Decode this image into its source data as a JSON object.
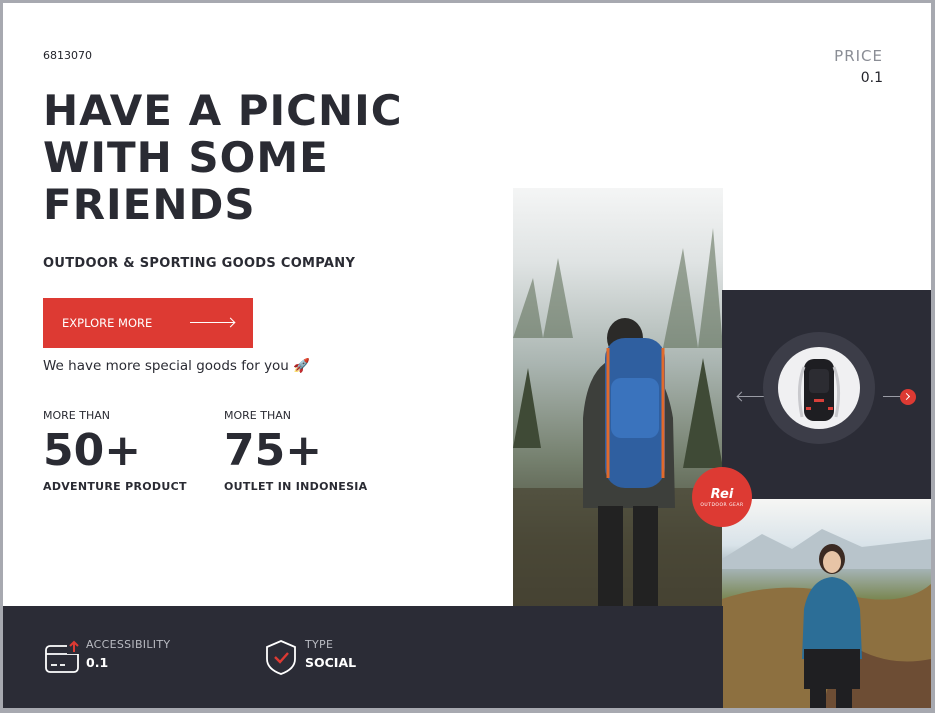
{
  "code": "6813070",
  "price": {
    "label": "PRICE",
    "value": "0.1"
  },
  "headline": [
    "HAVE A PICNIC",
    "WITH SOME",
    "FRIENDS"
  ],
  "subtitle": "OUTDOOR & SPORTING GOODS COMPANY",
  "cta": {
    "label": "EXPLORE MORE"
  },
  "tagline": "We have more special goods for you 🚀",
  "stats": [
    {
      "pre": "MORE THAN",
      "value": "50+",
      "caption": "ADVENTURE PRODUCT"
    },
    {
      "pre": "MORE THAN",
      "value": "75+",
      "caption": "OUTLET IN INDONESIA"
    }
  ],
  "footer": {
    "accessibility": {
      "label": "ACCESSIBILITY",
      "value": "0.1"
    },
    "type": {
      "label": "TYPE",
      "value": "SOCIAL"
    }
  },
  "badge": {
    "brand": "Rei",
    "sub": "OUTDOOR GEAR"
  },
  "colors": {
    "accent": "#dd3a33",
    "dark": "#2b2c36",
    "text": "#2a2b33"
  },
  "icons": [
    "card-upload-icon",
    "shield-check-icon",
    "arrow-right-icon",
    "arrow-left-icon"
  ]
}
